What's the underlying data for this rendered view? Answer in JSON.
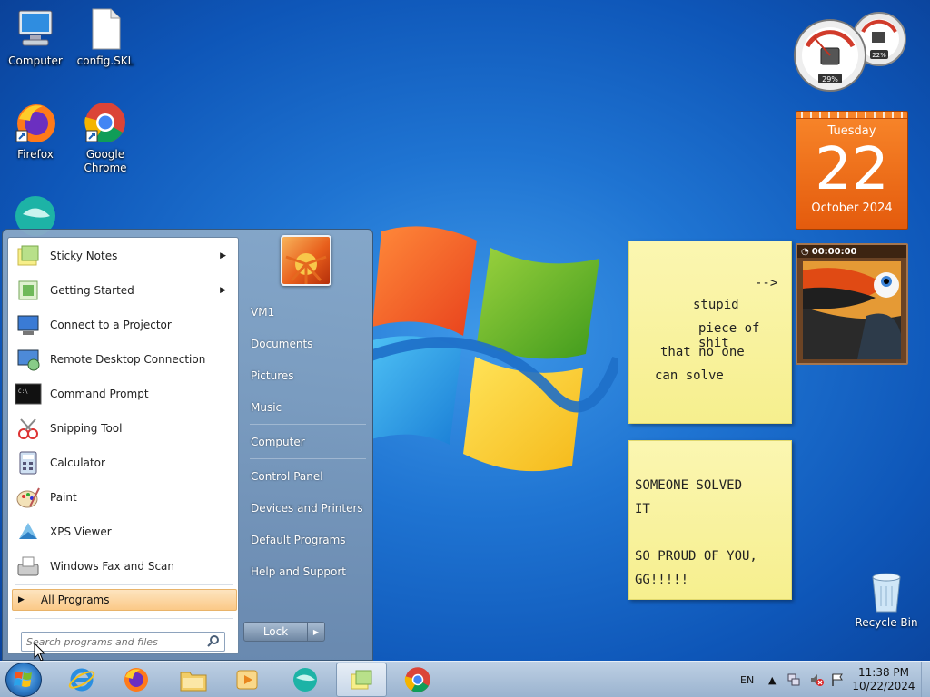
{
  "desktop": {
    "icons": [
      {
        "label": "Computer"
      },
      {
        "label": "config.SKL"
      },
      {
        "label": "Firefox"
      },
      {
        "label": "Google Chrome"
      },
      {
        "label": "Recycle Bin"
      }
    ]
  },
  "gadgets": {
    "meter": {
      "cpu": "29%",
      "memory": "22%"
    },
    "calendar": {
      "weekday": "Tuesday",
      "day": "22",
      "month_year": "October 2024"
    },
    "slideshow": {
      "time": "00:00:00"
    }
  },
  "sticky_notes": {
    "note1": {
      "arrow": "-->",
      "line1": "stupid",
      "line2": "piece of shit",
      "line3": "that no one",
      "line4": "can solve"
    },
    "note2": {
      "line1": "SOMEONE SOLVED",
      "line2": "IT",
      "line3": "SO PROUD OF YOU,",
      "line4": "GG!!!!!"
    }
  },
  "start_menu": {
    "programs": [
      {
        "label": "Sticky Notes"
      },
      {
        "label": "Getting Started"
      },
      {
        "label": "Connect to a Projector"
      },
      {
        "label": "Remote Desktop Connection"
      },
      {
        "label": "Command Prompt"
      },
      {
        "label": "Snipping Tool"
      },
      {
        "label": "Calculator"
      },
      {
        "label": "Paint"
      },
      {
        "label": "XPS Viewer"
      },
      {
        "label": "Windows Fax and Scan"
      }
    ],
    "all_programs": "All Programs",
    "search_placeholder": "Search programs and files",
    "right_items": [
      {
        "label": "VM1"
      },
      {
        "label": "Documents"
      },
      {
        "label": "Pictures"
      },
      {
        "label": "Music"
      },
      {
        "label": "Computer"
      },
      {
        "label": "Control Panel"
      },
      {
        "label": "Devices and Printers"
      },
      {
        "label": "Default Programs"
      },
      {
        "label": "Help and Support"
      }
    ],
    "lock_label": "Lock"
  },
  "taskbar": {
    "language": "EN",
    "time": "11:38 PM",
    "date": "10/22/2024"
  }
}
